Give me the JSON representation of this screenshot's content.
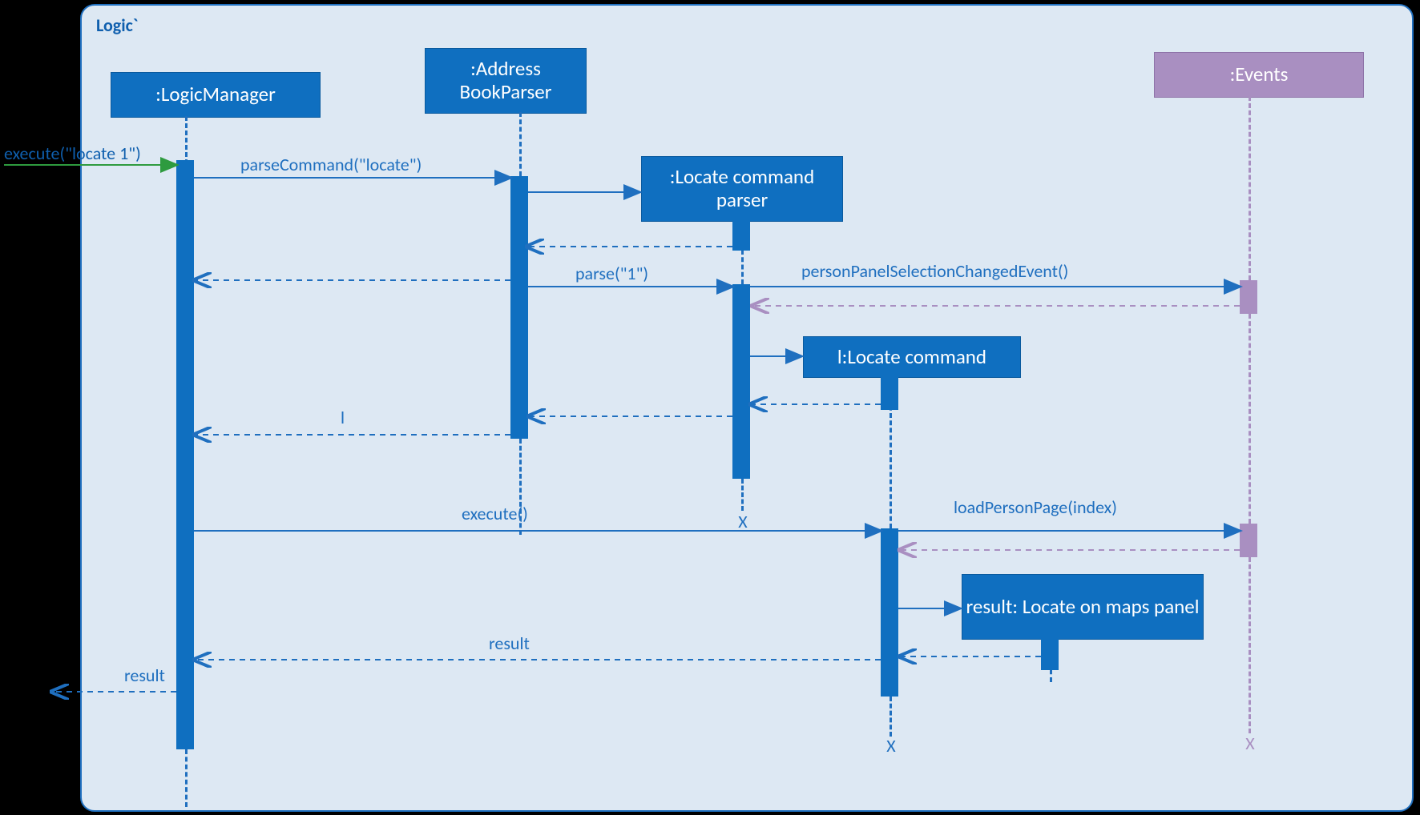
{
  "frame_label": "Logic`",
  "lifelines": {
    "logic_manager": ":LogicManager",
    "address_book_parser": ":Address BookParser",
    "locate_command_parser": ":Locate command parser",
    "locate_command": "l:Locate command",
    "result_panel": "result: Locate on maps panel",
    "events": ":Events"
  },
  "messages": {
    "execute_locate1": "execute(\"locate 1\")",
    "parse_command": "parseCommand(\"locate\")",
    "parse_one": "parse(\"1\")",
    "person_panel_event": "personPanelSelectionChangedEvent()",
    "return_l": "l",
    "execute": "execute()",
    "load_person_page": "loadPersonPage(index)",
    "result": "result"
  },
  "destroy": "X",
  "colors": {
    "frame_bg": "#DDE8F3",
    "frame_border": "#1F6FBF",
    "lifeline_blue": "#0F6FC0",
    "lifeline_purple": "#A98FC1",
    "text_blue": "#1F6FBF"
  }
}
